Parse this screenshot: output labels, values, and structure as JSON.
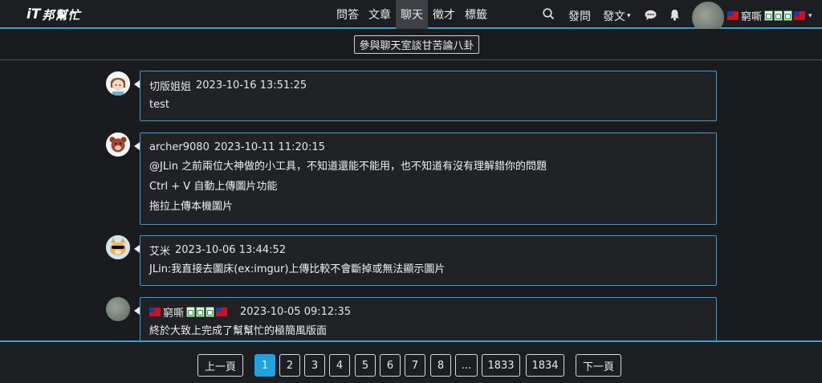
{
  "nav": {
    "logo_mark": "iT",
    "logo_text": "邦幫忙",
    "links": [
      {
        "label": "問答",
        "active": false
      },
      {
        "label": "文章",
        "active": false
      },
      {
        "label": "聊天",
        "active": true
      },
      {
        "label": "徵才",
        "active": false
      },
      {
        "label": "標籤",
        "active": false
      }
    ],
    "ask_label": "發問",
    "post_label": "發文",
    "post_caret": "▾",
    "user_caret": "▾",
    "user_name": "窮嘶"
  },
  "subbar": {
    "join_label": "參與聊天室談甘苦論八卦"
  },
  "messages": [
    {
      "author": "切版姐姐",
      "time": "2023-10-16 13:51:25",
      "lines": [
        "test"
      ]
    },
    {
      "author": "archer9080",
      "time": "2023-10-11 11:20:15",
      "lines": [
        "@JLin 之前兩位大神做的小工具，不知道還能不能用，也不知道有沒有理解錯你的問題",
        "Ctrl + V 自動上傳圖片功能",
        "拖拉上傳本機圖片"
      ]
    },
    {
      "author": "艾米",
      "time": "2023-10-06 13:44:52",
      "lines": [
        "JLin:我直接去圖床(ex:imgur)上傳比較不會斷掉或無法顯示圖片"
      ]
    },
    {
      "author": "窮嘶",
      "time": "2023-10-05 09:12:35",
      "lines": [
        "終於大致上完成了幫幫忙的極簡風版面"
      ]
    }
  ],
  "pagination": {
    "prev_label": "上一頁",
    "next_label": "下一頁",
    "pages": [
      "1",
      "2",
      "3",
      "4",
      "5",
      "6",
      "7",
      "8",
      "...",
      "1833",
      "1834"
    ],
    "current": "1"
  },
  "colors": {
    "accent": "#3a9fd6",
    "active_page": "#1ba3e6",
    "background": "#191b1f"
  }
}
